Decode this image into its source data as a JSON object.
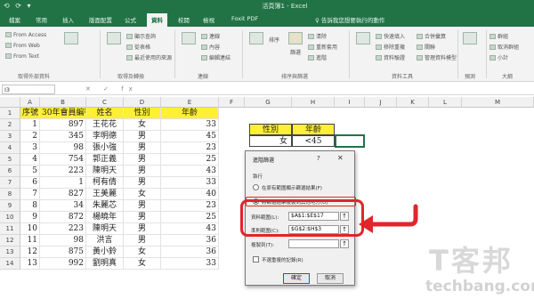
{
  "titlebar": {
    "qat": "⟲ ⟳ ▾",
    "title": "活頁簿1 - Excel"
  },
  "tabs": [
    "檔案",
    "常用",
    "插入",
    "版面配置",
    "公式",
    "資料",
    "校閱",
    "檢視",
    "Foxit PDF"
  ],
  "active_tab": "資料",
  "tell_me": "♀ 告訴我您想要執行的動作",
  "ribbon": {
    "external_items": [
      "From Access",
      "From Web",
      "From Text"
    ],
    "new_query_items": [
      "顯示查詢",
      "從表格",
      "最近使用的來源"
    ],
    "refresh_items": [
      "連線",
      "內容",
      "編輯連結"
    ],
    "sort_label": "排序",
    "filter_label": "篩選",
    "filter_items": [
      "清除",
      "重新套用",
      "進階"
    ],
    "tools_items": [
      "快速填入",
      "移除重複",
      "資料驗證"
    ],
    "right_items": [
      "合併彙算",
      "關聯",
      "管理資料模型"
    ],
    "outline_items": [
      "群組",
      "取消群組",
      "小計"
    ],
    "groups": [
      "取得外部資料",
      "取得及轉換",
      "連線",
      "排序與篩選",
      "資料工具",
      "預測",
      "大綱"
    ]
  },
  "formula": {
    "namebox": "I3",
    "icons": "✕ ✓ fx"
  },
  "columns": [
    "A",
    "B",
    "C",
    "D",
    "E",
    "F",
    "G",
    "H",
    "I",
    "J",
    "K",
    "L",
    "M"
  ],
  "rows": [
    "1",
    "2",
    "3",
    "4",
    "5",
    "6",
    "7",
    "8",
    "9",
    "10",
    "11",
    "12",
    "13",
    "14"
  ],
  "table": {
    "headers": [
      "序號",
      "30年會員編號",
      "姓名",
      "性別",
      "年齡"
    ],
    "rows": [
      [
        "1",
        "897",
        "王花花",
        "女",
        "33"
      ],
      [
        "2",
        "345",
        "李明德",
        "男",
        "45"
      ],
      [
        "3",
        "98",
        "張小強",
        "男",
        "23"
      ],
      [
        "4",
        "754",
        "郭正義",
        "男",
        "25"
      ],
      [
        "5",
        "223",
        "陳明天",
        "男",
        "43"
      ],
      [
        "6",
        "1",
        "柯有倩",
        "男",
        "33"
      ],
      [
        "7",
        "827",
        "王美麗",
        "女",
        "40"
      ],
      [
        "8",
        "34",
        "朱麗芯",
        "男",
        "23"
      ],
      [
        "9",
        "872",
        "楊曉年",
        "男",
        "25"
      ],
      [
        "10",
        "223",
        "陳明天",
        "男",
        "43"
      ],
      [
        "11",
        "98",
        "洪言",
        "男",
        "36"
      ],
      [
        "12",
        "875",
        "黃小鈴",
        "女",
        "36"
      ],
      [
        "13",
        "992",
        "劉明真",
        "女",
        "33"
      ]
    ],
    "partial_row": [
      "14",
      "146",
      "許生亨",
      "男",
      "33"
    ]
  },
  "criteria": {
    "h1": "性別",
    "h2": "年齡",
    "v1": "女",
    "v2": "<45"
  },
  "dialog": {
    "title": "進階篩選",
    "question": "?",
    "close": "✕",
    "action_label": "執行",
    "opt1": "在原有範圍顯示篩選結果(F)",
    "opt2": "將篩選結果複製到其他地方(O)",
    "list_range_label": "資料範圍(L):",
    "list_range_value": "$A$1:$E$17",
    "criteria_range_label": "準則範圍(C):",
    "criteria_range_value": "$G$2:$H$3",
    "copy_to_label": "複製到(T):",
    "copy_to_value": "",
    "collapse_glyph": "↑",
    "unique_label": "不選重複的記錄(R)",
    "ok": "確定",
    "cancel": "取消"
  },
  "watermark": {
    "big": "T客邦",
    "small": "techbang.com"
  },
  "colors": {
    "excel_green": "#217346",
    "highlight_yellow": "#ffef36",
    "annotation_red": "#e0252b"
  }
}
